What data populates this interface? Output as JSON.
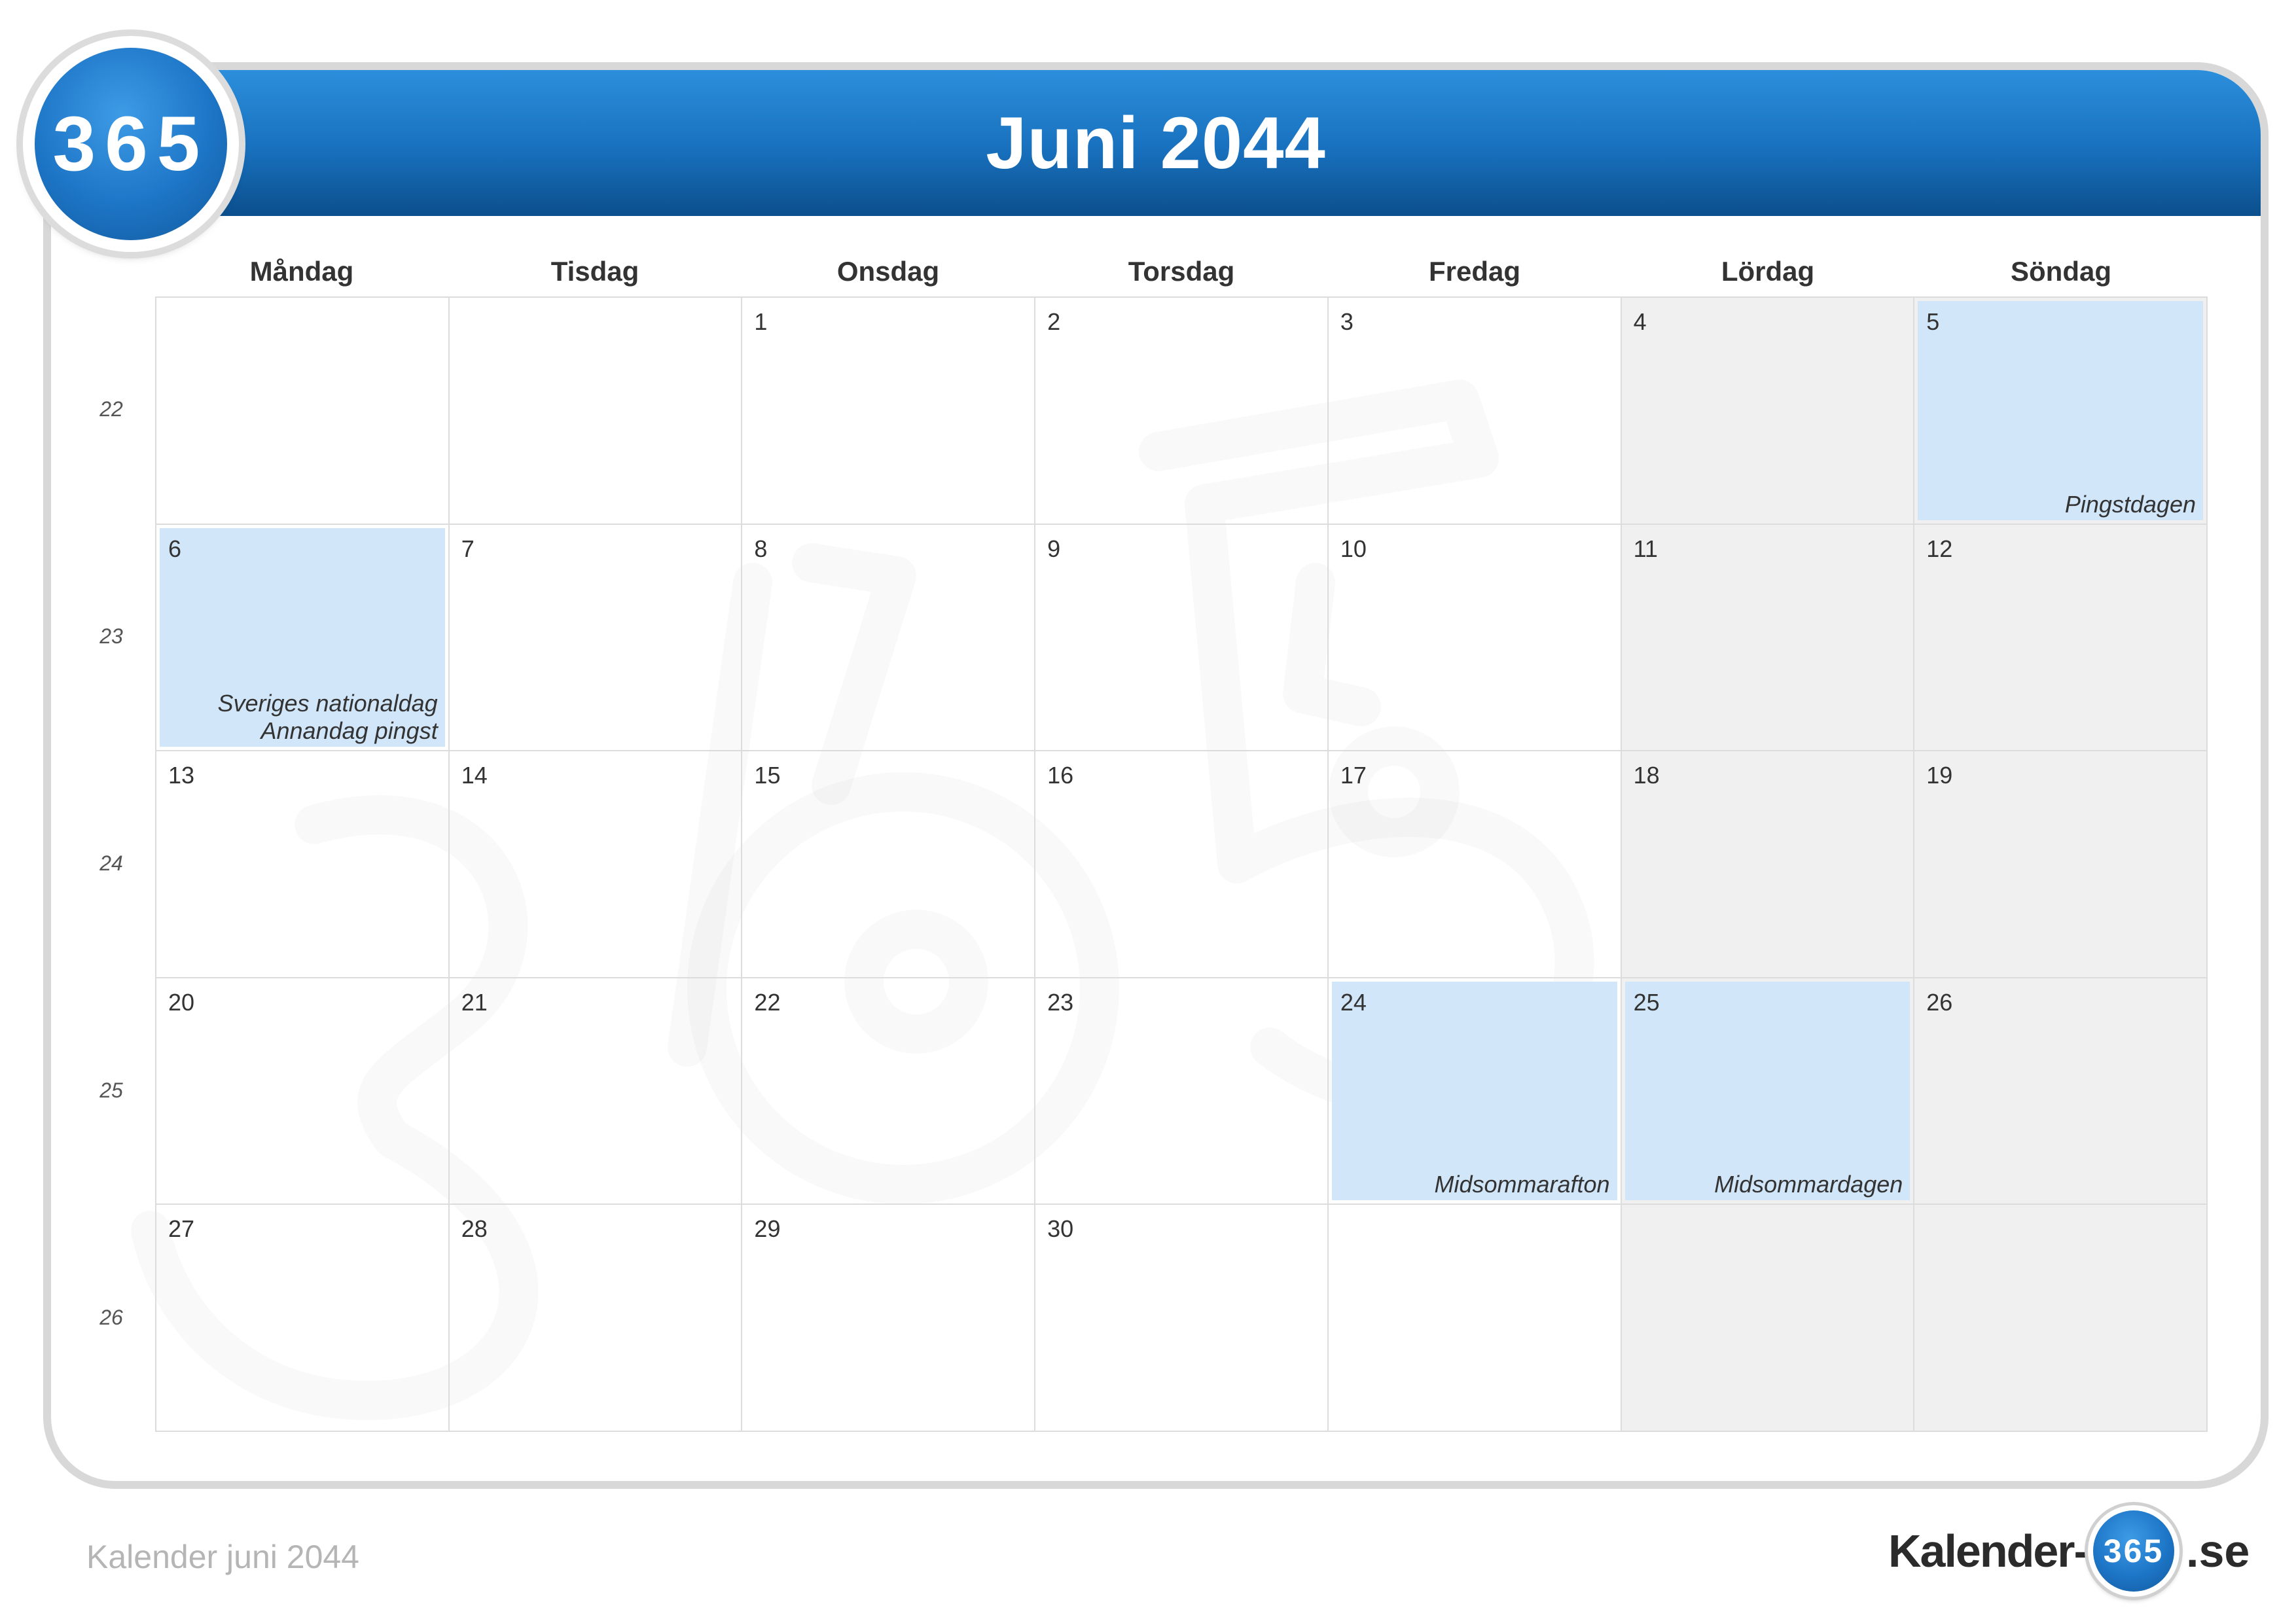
{
  "header": {
    "title": "Juni 2044",
    "logo_text": "365",
    "color": "#1870bd"
  },
  "weekdays": [
    "Måndag",
    "Tisdag",
    "Onsdag",
    "Torsdag",
    "Fredag",
    "Lördag",
    "Söndag"
  ],
  "weeks": [
    {
      "week": "22",
      "days": [
        {
          "day": "",
          "notes": []
        },
        {
          "day": "",
          "notes": []
        },
        {
          "day": "1",
          "notes": []
        },
        {
          "day": "2",
          "notes": []
        },
        {
          "day": "3",
          "notes": []
        },
        {
          "day": "4",
          "notes": []
        },
        {
          "day": "5",
          "notes": [
            "Pingstdagen"
          ]
        }
      ]
    },
    {
      "week": "23",
      "days": [
        {
          "day": "6",
          "notes": [
            "Sveriges nationaldag",
            "Annandag pingst"
          ]
        },
        {
          "day": "7",
          "notes": []
        },
        {
          "day": "8",
          "notes": []
        },
        {
          "day": "9",
          "notes": []
        },
        {
          "day": "10",
          "notes": []
        },
        {
          "day": "11",
          "notes": []
        },
        {
          "day": "12",
          "notes": []
        }
      ]
    },
    {
      "week": "24",
      "days": [
        {
          "day": "13",
          "notes": []
        },
        {
          "day": "14",
          "notes": []
        },
        {
          "day": "15",
          "notes": []
        },
        {
          "day": "16",
          "notes": []
        },
        {
          "day": "17",
          "notes": []
        },
        {
          "day": "18",
          "notes": []
        },
        {
          "day": "19",
          "notes": []
        }
      ]
    },
    {
      "week": "25",
      "days": [
        {
          "day": "20",
          "notes": []
        },
        {
          "day": "21",
          "notes": []
        },
        {
          "day": "22",
          "notes": []
        },
        {
          "day": "23",
          "notes": []
        },
        {
          "day": "24",
          "notes": [
            "Midsommarafton"
          ]
        },
        {
          "day": "25",
          "notes": [
            "Midsommardagen"
          ]
        },
        {
          "day": "26",
          "notes": []
        }
      ]
    },
    {
      "week": "26",
      "days": [
        {
          "day": "27",
          "notes": []
        },
        {
          "day": "28",
          "notes": []
        },
        {
          "day": "29",
          "notes": []
        },
        {
          "day": "30",
          "notes": []
        },
        {
          "day": "",
          "notes": []
        },
        {
          "day": "",
          "notes": []
        },
        {
          "day": "",
          "notes": []
        }
      ]
    }
  ],
  "footer": {
    "caption": "Kalender juni 2044",
    "brand_left": "Kalender-",
    "brand_badge": "365",
    "brand_right": ".se"
  }
}
